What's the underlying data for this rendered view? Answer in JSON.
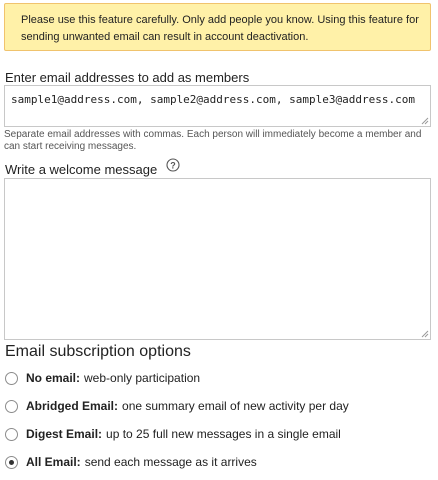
{
  "warning": {
    "text": "Please use this feature carefully. Only add people you know. Using this feature for sending unwanted email can result in account deactivation."
  },
  "members": {
    "label": "Enter email addresses to add as members",
    "value": "sample1@address.com, sample2@address.com, sample3@address.com",
    "hint": "Separate email addresses with commas. Each person will immediately become a member and can start receiving messages."
  },
  "welcome": {
    "label": "Write a welcome message",
    "value": "",
    "help_icon": "question-circle-icon"
  },
  "subscription": {
    "title": "Email subscription options",
    "options": [
      {
        "name": "No email:",
        "desc": "web-only participation",
        "selected": false
      },
      {
        "name": "Abridged Email:",
        "desc": "one summary email of new activity per day",
        "selected": false
      },
      {
        "name": "Digest Email:",
        "desc": "up to 25 full new messages in a single email",
        "selected": false
      },
      {
        "name": "All Email:",
        "desc": "send each message as it arrives",
        "selected": true
      }
    ]
  }
}
